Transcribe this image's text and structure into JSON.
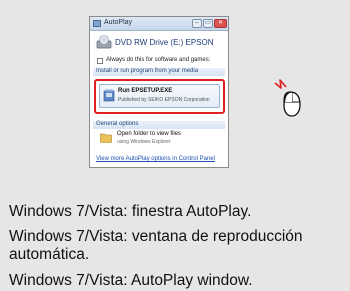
{
  "dialog": {
    "window_title": "AutoPlay",
    "buttons": {
      "minimize": "–",
      "maximize": "▭",
      "close": "✕"
    },
    "drive_title": "DVD RW Drive (E:) EPSON",
    "always_do_label": "Always do this for software and games:",
    "install_section_label": "Install or run program from your media",
    "run_item_name": "Run EPSETUP.EXE",
    "run_item_publisher": "Published by SEIKO EPSON Corporation",
    "general_section_label": "General options",
    "folder_item_name": "Open folder to view files",
    "folder_item_sub": "using Windows Explorer",
    "more_link": "View more AutoPlay options in Control Panel"
  },
  "captions": {
    "italian": "Windows 7/Vista: finestra AutoPlay.",
    "spanish": "Windows 7/Vista: ventana de reproducción automática.",
    "english": "Windows 7/Vista: AutoPlay window."
  },
  "colors": {
    "highlight": "#e02020",
    "link": "#1a4fb0",
    "background": "#e6e6e6"
  },
  "icons": [
    "dvd-drive-icon",
    "setup-program-icon",
    "folder-icon",
    "mouse-click-icon"
  ]
}
